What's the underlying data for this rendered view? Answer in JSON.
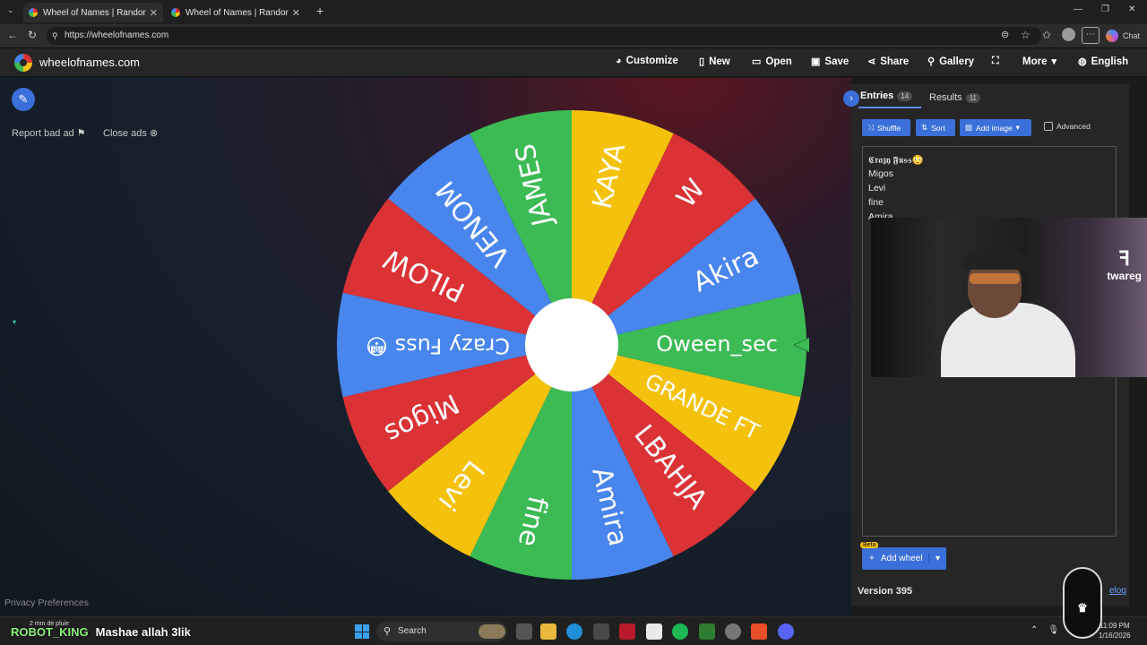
{
  "browser": {
    "tabs": [
      {
        "title": "Wheel of Names | Random name p",
        "active": true
      },
      {
        "title": "Wheel of Names | Random name p",
        "active": false
      }
    ],
    "new_tab": "+",
    "url": "https://wheelofnames.com",
    "chat_label": "Chat",
    "window_controls": [
      "—",
      "❐",
      "✕"
    ]
  },
  "site": {
    "name": "wheelofnames.com",
    "nav": [
      {
        "label": "Customize",
        "icon": "palette-icon",
        "glyph": "🎨"
      },
      {
        "label": "New",
        "icon": "file-icon",
        "glyph": "🗋"
      },
      {
        "label": "Open",
        "icon": "folder-icon",
        "glyph": "🗁"
      },
      {
        "label": "Save",
        "icon": "floppy-icon",
        "glyph": "💾"
      },
      {
        "label": "Share",
        "icon": "share-icon",
        "glyph": "⋖"
      },
      {
        "label": "Gallery",
        "icon": "search-icon",
        "glyph": "🔍"
      },
      {
        "label": "",
        "icon": "fullscreen-icon",
        "glyph": "⛶"
      },
      {
        "label": "More",
        "icon": "chevron-down-icon",
        "glyph": "▾"
      },
      {
        "label": "English",
        "icon": "globe-icon",
        "glyph": "🌐"
      }
    ]
  },
  "ads": {
    "report": "Report bad ad",
    "close": "Close ads",
    "privacy": "Privacy Preferences"
  },
  "wheel": {
    "segments": [
      {
        "label": "Oween_sec",
        "color": "#3cba54"
      },
      {
        "label": "GRANDE FT",
        "color": "#f4c20d"
      },
      {
        "label": "LBAHJA",
        "color": "#db3236"
      },
      {
        "label": "Amira",
        "color": "#4885ed"
      },
      {
        "label": "fine",
        "color": "#3cba54"
      },
      {
        "label": "Levi",
        "color": "#f4c20d"
      },
      {
        "label": "Migos",
        "color": "#db3236"
      },
      {
        "label": "Crazy Fuss 😳",
        "color": "#4885ed"
      },
      {
        "label": "PILOW",
        "color": "#db3236"
      },
      {
        "label": "VENOM",
        "color": "#4885ed"
      },
      {
        "label": "JAMES",
        "color": "#3cba54"
      },
      {
        "label": "KAYA",
        "color": "#f4c20d"
      },
      {
        "label": "W",
        "color": "#db3236"
      },
      {
        "label": "Akira",
        "color": "#4885ed"
      }
    ]
  },
  "panel": {
    "entries_tab": "Entries",
    "entries_count": "14",
    "results_tab": "Results",
    "results_count": "11",
    "buttons": {
      "shuffle": "Shuffle",
      "sort": "Sort",
      "add_image": "Add image",
      "advanced": "Advanced"
    },
    "entries": [
      "𝕮𝖗𝖆𝖟𝖞 𝕱𝖚𝖘𝖘😳",
      "Migos",
      "Levi",
      "fine",
      "Amira"
    ],
    "beta": "Beta",
    "add_wheel": "Add wheel",
    "version": "Version 395",
    "changelog": "Changelog"
  },
  "stream": {
    "name": "ROBOT_KING",
    "message": "Mashae allah 3lik",
    "weather": "2 mm de pluie",
    "cam_brand": "twareg"
  },
  "taskbar": {
    "search": "Search",
    "time": "11:09 PM",
    "date": "1/16/2026"
  }
}
